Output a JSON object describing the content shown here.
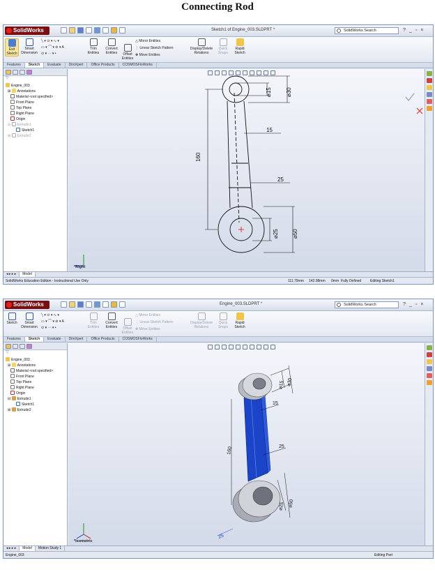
{
  "page_title": "Connecting Rod",
  "app_logo": "SolidWorks",
  "search_placeholder": "SolidWorks Search",
  "window_controls": [
    "?",
    "_",
    "▫",
    "×"
  ],
  "sketch_ribbon": {
    "exit_sketch": "Exit Sketch",
    "sketch": "Sketch",
    "smart_dimension": "Smart Dimension",
    "trim_entities": "Trim Entities",
    "convert_entities": "Convert Entities",
    "offset_entities": "Offset Entities",
    "mirror_entities": "Mirror Entities",
    "linear_sketch_pattern": "Linear Sketch Pattern",
    "move_entities": "Move Entities",
    "display_delete_relations": "Display/Delete Relations",
    "quick_snaps": "Quick Snaps",
    "rapid_sketch": "Rapid Sketch"
  },
  "cmd_tabs": [
    "Features",
    "Sketch",
    "Evaluate",
    "DimXpert",
    "Office Products",
    "COSMOSFloWorks"
  ],
  "tree": {
    "filter": "▽",
    "part": "Engine_003",
    "annotations": "Annotations",
    "material": "Material <not specified>",
    "front_plane": "Front Plane",
    "top_plane": "Top Plane",
    "right_plane": "Right Plane",
    "origin": "Origin",
    "extrude1": "Extrude1",
    "sketch1": "Sketch1",
    "extrude2": "Extrude2"
  },
  "icons": {
    "logo": "solidworks-logo-icon",
    "search": "search-icon"
  },
  "colors": {
    "accent": "#3f6fc6",
    "blue_solid": "#1b44c8",
    "tree_highlight": "#3f6fc6",
    "red_logo": "#7a0f12"
  },
  "window1": {
    "doc_title": "Sketch1 of Engine_003.SLDPRT *",
    "view_label": "*Right",
    "bottom_tabs": [
      "Model"
    ],
    "status": {
      "edition": "SolidWorks Education Edition - Instructional Use Only",
      "x": "111.79mm",
      "y": "142.98mm",
      "z": "0mm",
      "defined": "Fully Defined",
      "mode": "Editing Sketch1"
    },
    "dims": {
      "d15": "⌀15",
      "d30": "⌀30",
      "w15": "15",
      "length": "160",
      "w25": "25",
      "d25": "⌀25",
      "d50": "⌀50"
    }
  },
  "window2": {
    "doc_title": "Engine_003.SLDPRT *",
    "view_label": "*Isometric",
    "bottom_tabs": [
      "Model",
      "Motion Study 1"
    ],
    "status": {
      "part": "Engine_003",
      "mode": "Editing Part"
    },
    "dims": {
      "d15": "⌀15",
      "d30": "⌀30",
      "w15": "15",
      "length": "160",
      "w25": "25",
      "d25": "⌀25",
      "d50": "⌀50",
      "side": "25"
    }
  }
}
